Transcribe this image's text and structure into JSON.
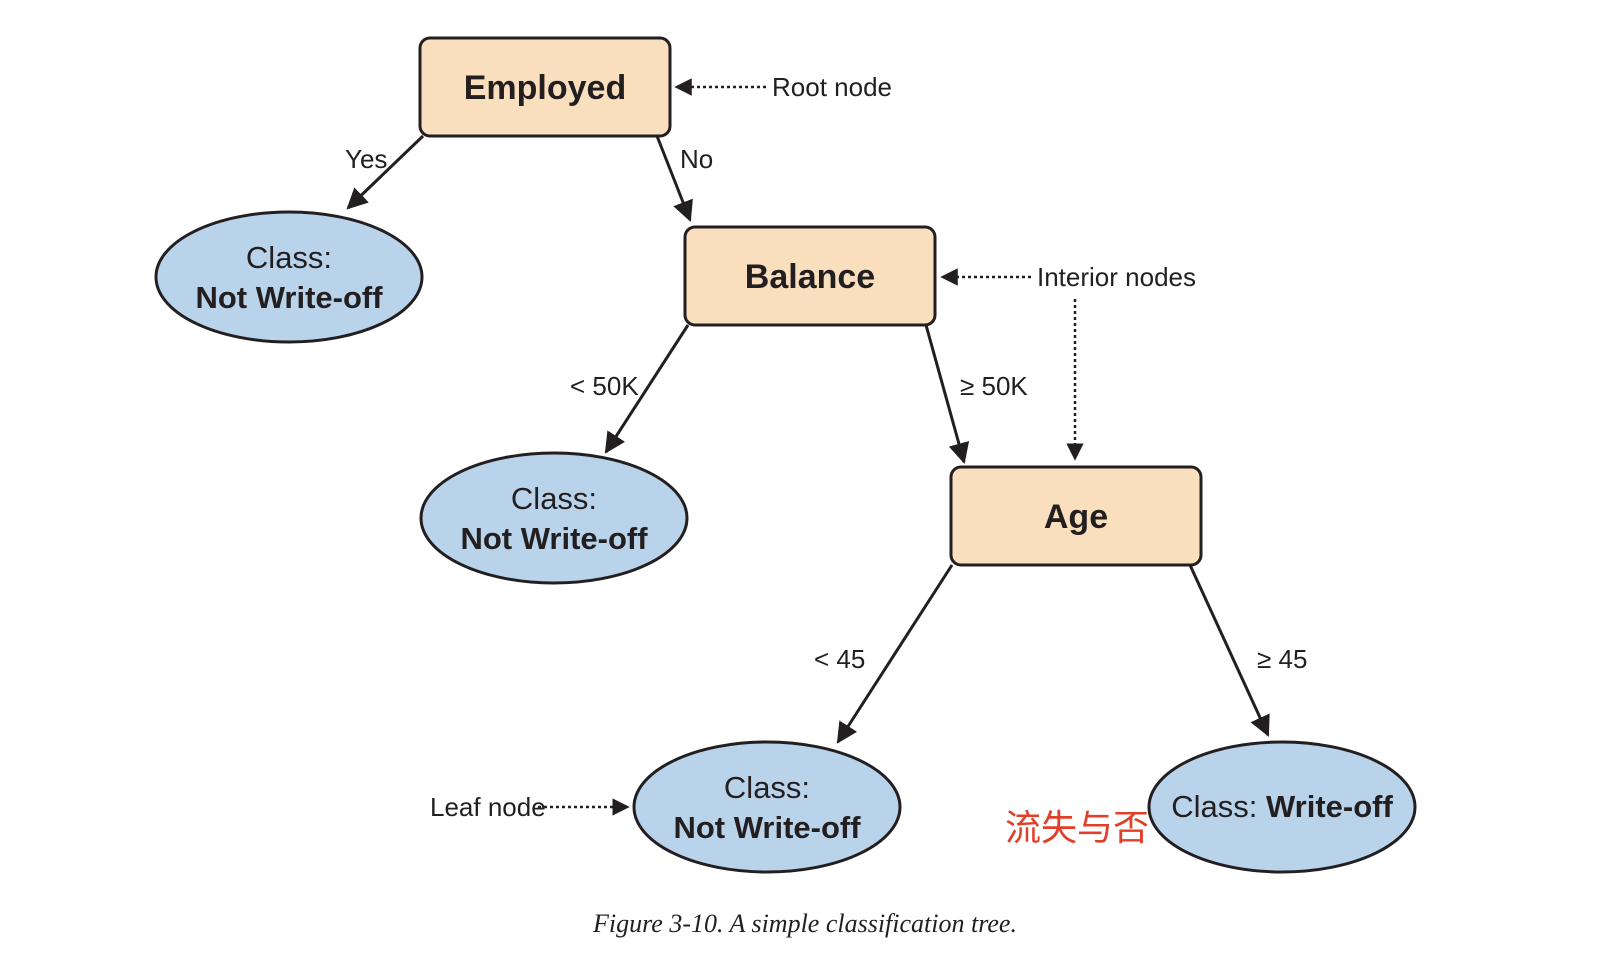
{
  "nodes": {
    "employed": "Employed",
    "balance": "Balance",
    "age": "Age"
  },
  "leaves": {
    "leaf1": {
      "line1": "Class:",
      "line2": "Not Write-off"
    },
    "leaf2": {
      "line1": "Class:",
      "line2": "Not Write-off"
    },
    "leaf3": {
      "line1": "Class:",
      "line2": "Not Write-off"
    },
    "leaf4": {
      "prefix": "Class: ",
      "value": "Write-off"
    }
  },
  "edges": {
    "employed_yes": "Yes",
    "employed_no": "No",
    "balance_lt": "< 50K",
    "balance_ge": "≥ 50K",
    "age_lt": "< 45",
    "age_ge": "≥ 45"
  },
  "annotations": {
    "root": "Root node",
    "interior": "Interior nodes",
    "leaf": "Leaf node"
  },
  "overlay_text": "流失与否",
  "caption": "Figure 3-10. A simple classification tree.",
  "colors": {
    "decision_fill": "#f9dfbe",
    "leaf_fill": "#b9d3ea",
    "stroke": "#231f20",
    "overlay": "#e0402a"
  }
}
